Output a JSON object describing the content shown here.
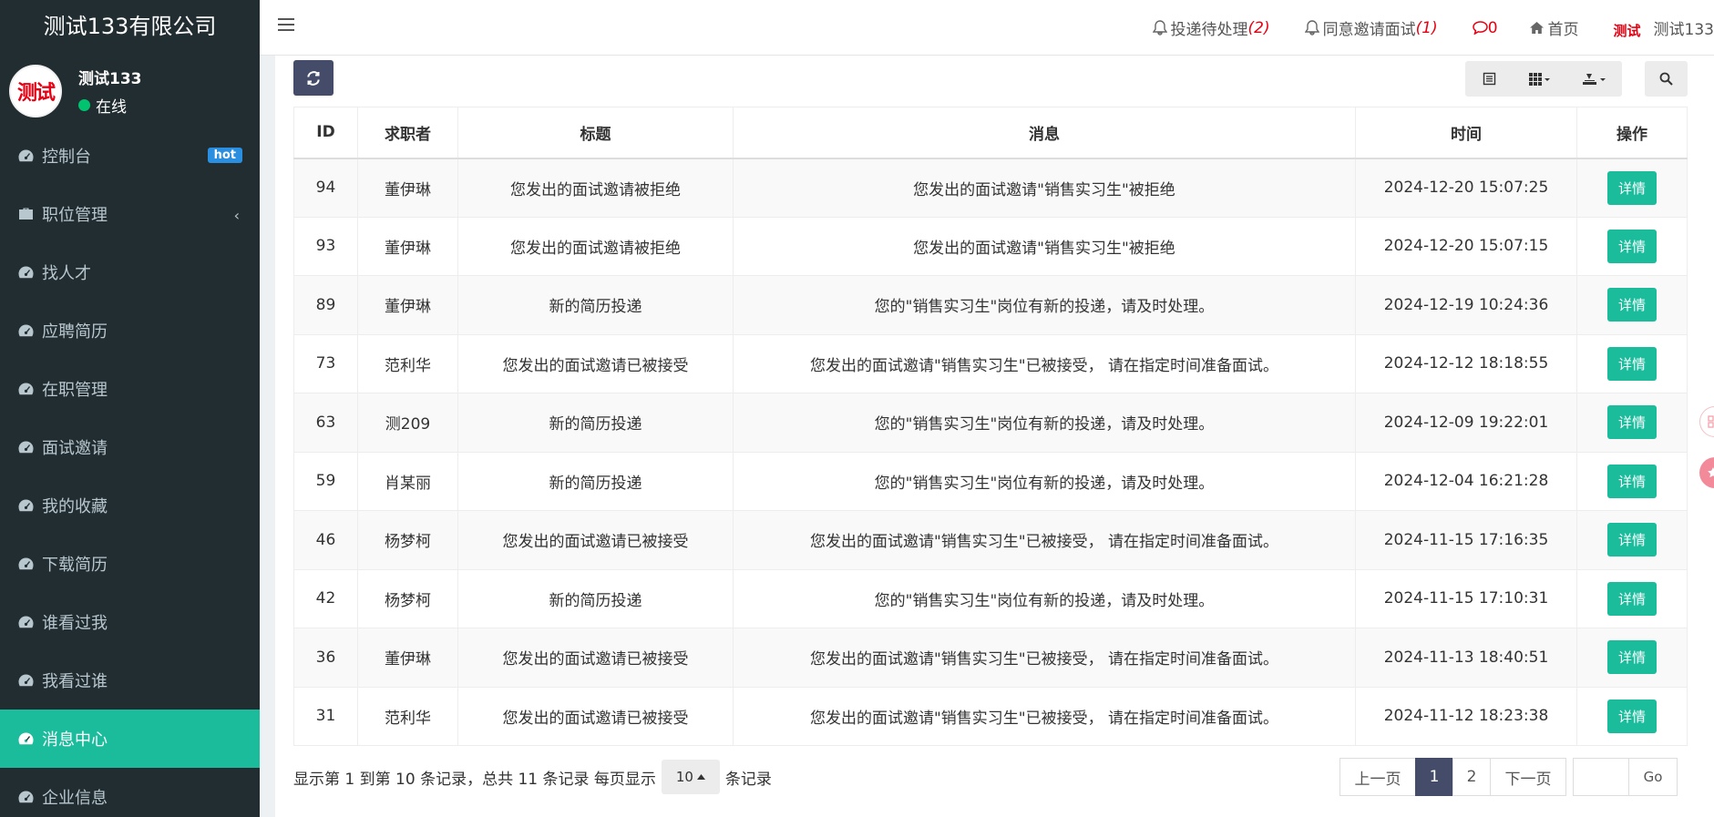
{
  "sidebar": {
    "company": "测试133有限公司",
    "avatar_text": "测试",
    "user_name": "测试133",
    "status": "在线",
    "items": [
      {
        "label": "控制台",
        "icon": "dashboard-icon",
        "badge": "hot"
      },
      {
        "label": "职位管理",
        "icon": "briefcase-icon"
      },
      {
        "label": "找人才",
        "icon": "dashboard-icon"
      },
      {
        "label": "应聘简历",
        "icon": "dashboard-icon"
      },
      {
        "label": "在职管理",
        "icon": "dashboard-icon"
      },
      {
        "label": "面试邀请",
        "icon": "dashboard-icon"
      },
      {
        "label": "我的收藏",
        "icon": "dashboard-icon"
      },
      {
        "label": "下载简历",
        "icon": "dashboard-icon"
      },
      {
        "label": "谁看过我",
        "icon": "dashboard-icon"
      },
      {
        "label": "我看过谁",
        "icon": "dashboard-icon"
      },
      {
        "label": "消息中心",
        "icon": "dashboard-icon",
        "active": true
      },
      {
        "label": "企业信息",
        "icon": "dashboard-icon"
      }
    ]
  },
  "topbar": {
    "pending_label": "投递待处理",
    "pending_count": "(2)",
    "interview_label": "同意邀请面试",
    "interview_count": "(1)",
    "message_count": "0",
    "home_label": "首页",
    "avatar_text": "测试",
    "user_name": "测试133"
  },
  "table": {
    "columns": [
      "ID",
      "求职者",
      "标题",
      "消息",
      "时间",
      "操作"
    ],
    "detail_label": "详情",
    "rows": [
      {
        "id": "94",
        "seeker": "董伊琳",
        "title": "您发出的面试邀请被拒绝",
        "message": "您发出的面试邀请\"销售实习生\"被拒绝",
        "time": "2024-12-20 15:07:25"
      },
      {
        "id": "93",
        "seeker": "董伊琳",
        "title": "您发出的面试邀请被拒绝",
        "message": "您发出的面试邀请\"销售实习生\"被拒绝",
        "time": "2024-12-20 15:07:15"
      },
      {
        "id": "89",
        "seeker": "董伊琳",
        "title": "新的简历投递",
        "message": "您的\"销售实习生\"岗位有新的投递，请及时处理。",
        "time": "2024-12-19 10:24:36"
      },
      {
        "id": "73",
        "seeker": "范利华",
        "title": "您发出的面试邀请已被接受",
        "message": "您发出的面试邀请\"销售实习生\"已被接受， 请在指定时间准备面试。",
        "time": "2024-12-12 18:18:55"
      },
      {
        "id": "63",
        "seeker": "测209",
        "title": "新的简历投递",
        "message": "您的\"销售实习生\"岗位有新的投递，请及时处理。",
        "time": "2024-12-09 19:22:01"
      },
      {
        "id": "59",
        "seeker": "肖某丽",
        "title": "新的简历投递",
        "message": "您的\"销售实习生\"岗位有新的投递，请及时处理。",
        "time": "2024-12-04 16:21:28"
      },
      {
        "id": "46",
        "seeker": "杨梦柯",
        "title": "您发出的面试邀请已被接受",
        "message": "您发出的面试邀请\"销售实习生\"已被接受， 请在指定时间准备面试。",
        "time": "2024-11-15 17:16:35"
      },
      {
        "id": "42",
        "seeker": "杨梦柯",
        "title": "新的简历投递",
        "message": "您的\"销售实习生\"岗位有新的投递，请及时处理。",
        "time": "2024-11-15 17:10:31"
      },
      {
        "id": "36",
        "seeker": "董伊琳",
        "title": "您发出的面试邀请已被接受",
        "message": "您发出的面试邀请\"销售实习生\"已被接受， 请在指定时间准备面试。",
        "time": "2024-11-13 18:40:51"
      },
      {
        "id": "31",
        "seeker": "范利华",
        "title": "您发出的面试邀请已被接受",
        "message": "您发出的面试邀请\"销售实习生\"已被接受， 请在指定时间准备面试。",
        "time": "2024-11-12 18:23:38"
      }
    ]
  },
  "pager": {
    "summary": "显示第 1 到第 10 条记录，总共 11 条记录 每页显示",
    "page_size": "10",
    "suffix": "条记录",
    "prev": "上一页",
    "pages": [
      "1",
      "2"
    ],
    "current": "1",
    "next": "下一页",
    "go": "Go"
  },
  "colors": {
    "accent": "#1abc9c",
    "sidebar_bg": "#222d32",
    "primary_dark": "#444c69",
    "alert": "#e60012"
  }
}
